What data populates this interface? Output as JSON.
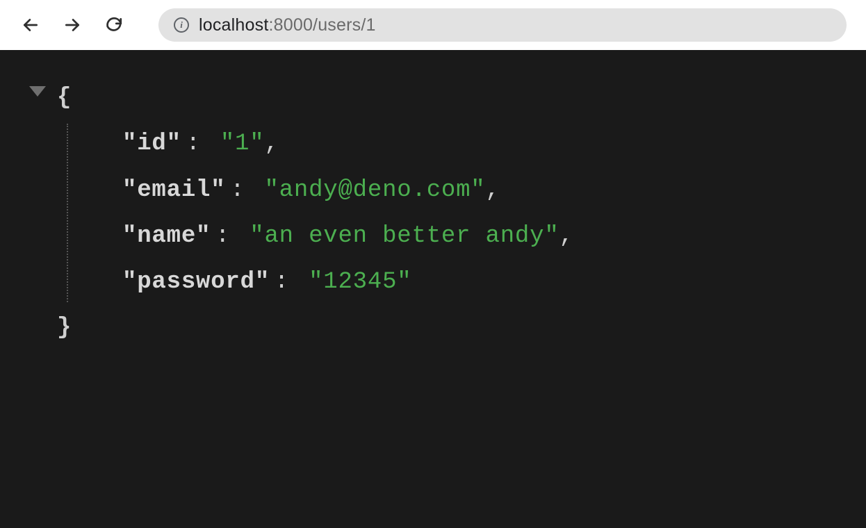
{
  "browser": {
    "url_host": "localhost",
    "url_port_path": ":8000/users/1"
  },
  "json": {
    "open_brace": "{",
    "close_brace": "}",
    "entries": [
      {
        "key": "\"id\"",
        "value": "\"1\"",
        "comma": ","
      },
      {
        "key": "\"email\"",
        "value": "\"andy@deno.com\"",
        "comma": ","
      },
      {
        "key": "\"name\"",
        "value": "\"an even better andy\"",
        "comma": ","
      },
      {
        "key": "\"password\"",
        "value": "\"12345\"",
        "comma": ""
      }
    ]
  }
}
